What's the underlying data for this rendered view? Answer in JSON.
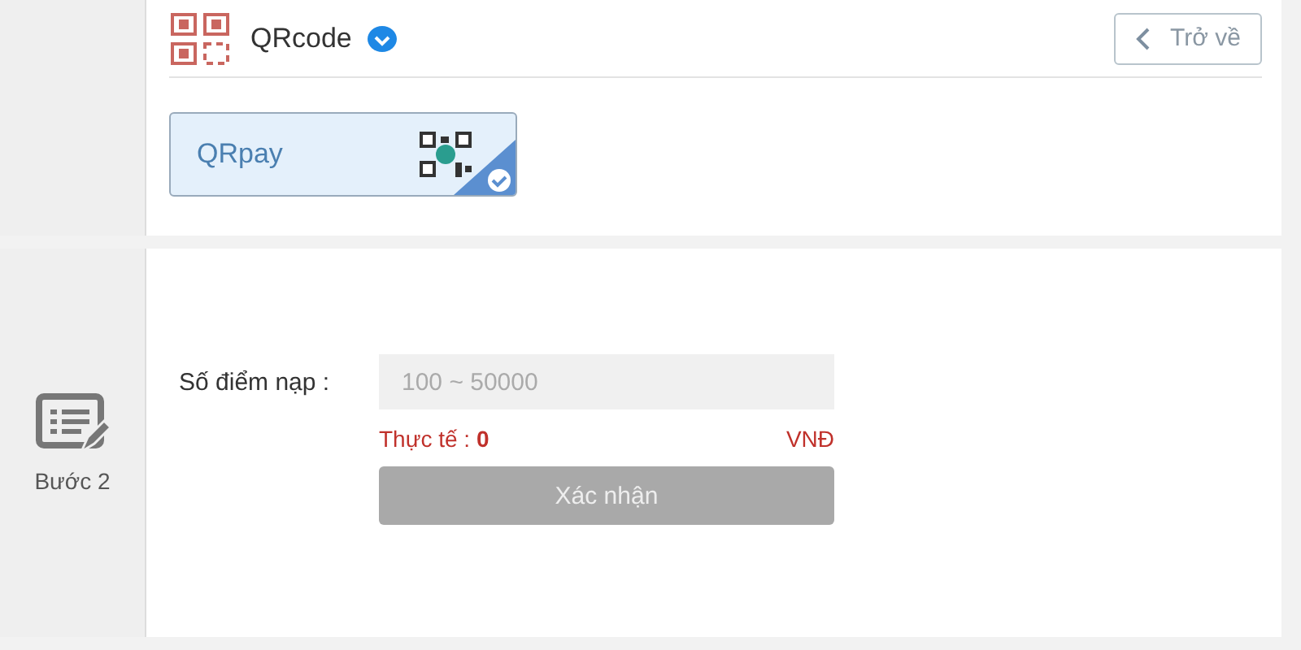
{
  "method": {
    "title": "QRcode",
    "verified": true,
    "back_button": "Trở về",
    "options": [
      {
        "label": "QRpay",
        "selected": true
      }
    ]
  },
  "step2": {
    "step_label": "Bước 2",
    "amount_label": "Số điểm nạp :",
    "amount_field": {
      "placeholder": "100 ~ 50000"
    },
    "actual_label": "Thực tế :",
    "actual_value": "0",
    "currency": "VNĐ",
    "confirm_button": {
      "label": "Xác nhận",
      "disabled": true
    }
  }
}
